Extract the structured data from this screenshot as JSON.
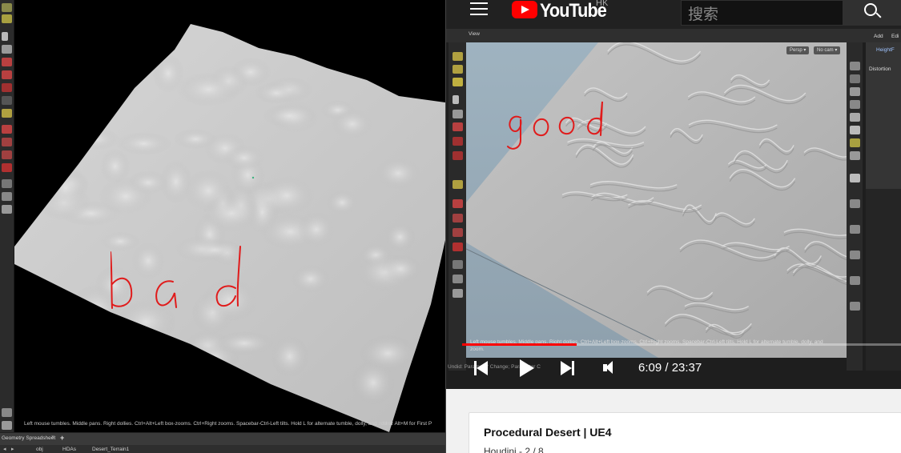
{
  "left": {
    "annotation": "bad",
    "hint_text": "Left mouse tumbles. Middle pans. Right dollies. Ctrl+Alt+Left box-zooms. Ctrl+Right zooms. Spacebar-Ctrl-Left tilts. Hold L for alternate tumble, dolly, and zoom.",
    "hint_text_2": "M or Alt+M for First P",
    "bottom_tab": "Geometry Spreadsheet",
    "path": [
      "obj",
      "HDAs",
      "Desert_Terrain1"
    ]
  },
  "youtube": {
    "logo_text": "YouTube",
    "region": "HK",
    "search_placeholder": "搜索",
    "video": {
      "view_label": "View",
      "persp_label": "Persp ▾",
      "cam_label": "No cam ▾",
      "distortion_label": "Distortion",
      "heightfield_label": "HeightF",
      "add_label": "Add",
      "edit_label": "Edi",
      "annotation": "good",
      "hint_text": "Left mouse tumbles. Middle pans. Right dollies. Ctrl+Alt+Left box-zooms. Ctrl+Right zooms. Spacebar-Ctrl-Left tilts. Hold L for alternate tumble, dolly, and zoom.",
      "undid_text": "Undid: Parameter Change; Parameter C",
      "current_time": "6:09",
      "duration": "23:37",
      "time_display": "6:09 / 23:37",
      "progress_fraction": 0.26
    },
    "title": "Procedural Desert | UE4",
    "subtitle": "Houdini - 2 / 8"
  },
  "colors": {
    "annotation_red": "#e01b1b",
    "youtube_red": "#ff0000",
    "header_bg": "#212121"
  }
}
